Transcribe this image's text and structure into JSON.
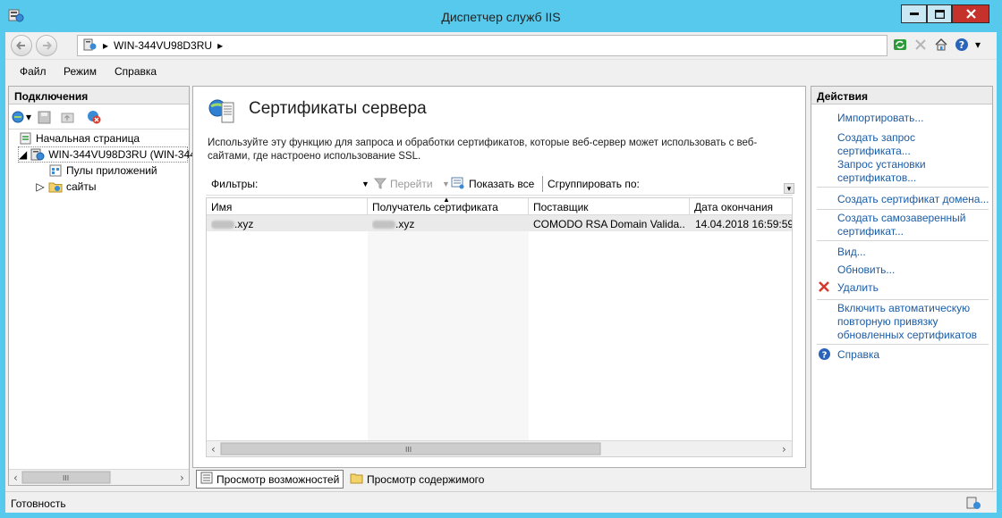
{
  "window": {
    "title": "Диспетчер служб IIS"
  },
  "address": {
    "segments": [
      "WIN-344VU98D3RU"
    ]
  },
  "menu": {
    "items": [
      "Файл",
      "Режим",
      "Справка"
    ]
  },
  "connections": {
    "header": "Подключения",
    "tree": {
      "start_page": "Начальная страница",
      "server": "WIN-344VU98D3RU (WIN-344",
      "app_pools": "Пулы приложений",
      "sites": "сайты"
    }
  },
  "center": {
    "title": "Сертификаты сервера",
    "description": "Используйте эту функцию для запроса и обработки сертификатов, которые веб-сервер может использовать с веб-сайтами, где настроено использование SSL.",
    "filter_label": "Фильтры:",
    "go_label": "Перейти",
    "show_all_label": "Показать все",
    "group_by_label": "Сгруппировать по:",
    "columns": [
      "Имя",
      "Получатель сертификата",
      "Поставщик",
      "Дата окончания"
    ],
    "rows": [
      {
        "name": ".xyz",
        "subject": ".xyz",
        "issuer": "COMODO RSA Domain Valida...",
        "expires": "14.04.2018 16:59:59"
      }
    ]
  },
  "view_tabs": {
    "features": "Просмотр возможностей",
    "content": "Просмотр содержимого"
  },
  "actions": {
    "header": "Действия",
    "import": "Импортировать...",
    "create_request": "Создать запрос сертификата...",
    "complete_request": "Запрос установки сертификатов...",
    "create_domain": "Создать сертификат домена...",
    "create_self_signed": "Создать самозаверенный сертификат...",
    "view": "Вид...",
    "renew": "Обновить...",
    "remove": "Удалить",
    "auto_rebind": "Включить автоматическую повторную привязку обновленных сертификатов",
    "help": "Справка"
  },
  "status": {
    "text": "Готовность"
  }
}
